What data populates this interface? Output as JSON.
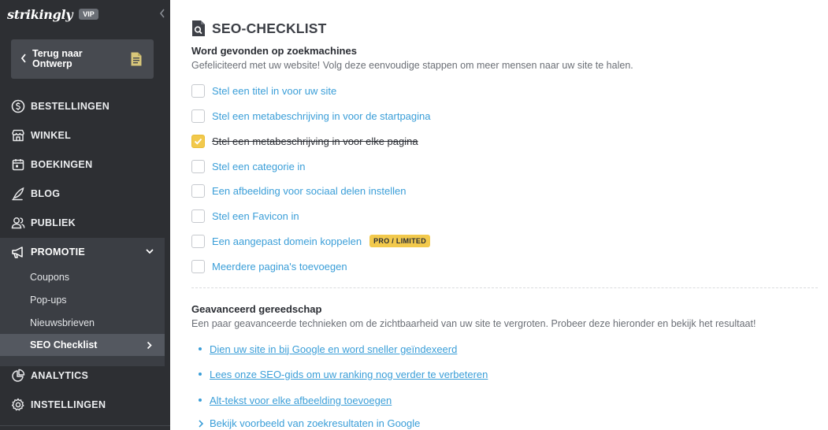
{
  "sidebar": {
    "brand": "strikingly",
    "vip_badge": "VIP",
    "back_button": "Terug naar Ontwerp",
    "nav": {
      "orders": "BESTELLINGEN",
      "store": "WINKEL",
      "bookings": "BOEKINGEN",
      "blog": "BLOG",
      "audience": "PUBLIEK",
      "promotion": "PROMOTIE",
      "analytics": "ANALYTICS",
      "settings": "INSTELLINGEN"
    },
    "promotion_sub": {
      "coupons": "Coupons",
      "popups": "Pop-ups",
      "newsletters": "Nieuwsbrieven",
      "seo": "SEO Checklist"
    }
  },
  "main": {
    "title": "SEO-CHECKLIST",
    "section1": {
      "heading": "Word gevonden op zoekmachines",
      "description": "Gefeliciteerd met uw website! Volg deze eenvoudige stappen om meer mensen naar uw site te halen.",
      "items": [
        {
          "label": "Stel een titel in voor uw site",
          "checked": false
        },
        {
          "label": "Stel een metabeschrijving in voor de startpagina",
          "checked": false
        },
        {
          "label": "Stel een metabeschrijving in voor elke pagina",
          "checked": true
        },
        {
          "label": "Stel een categorie in",
          "checked": false
        },
        {
          "label": "Een afbeelding voor sociaal delen instellen",
          "checked": false
        },
        {
          "label": "Stel een Favicon in",
          "checked": false
        },
        {
          "label": "Een aangepast domein koppelen",
          "checked": false,
          "badge": "PRO / LIMITED"
        },
        {
          "label": "Meerdere pagina's toevoegen",
          "checked": false
        }
      ]
    },
    "section2": {
      "heading": "Geavanceerd gereedschap",
      "description": "Een paar geavanceerde technieken om de zichtbaarheid van uw site te vergroten. Probeer deze hieronder en bekijk het resultaat!",
      "links": [
        "Dien uw site in bij Google en word sneller geïndexeerd",
        "Lees onze SEO-gids om uw ranking nog verder te verbeteren",
        "Alt-tekst voor elke afbeelding toevoegen"
      ],
      "expander": "Bekijk voorbeeld van zoekresultaten in Google"
    }
  },
  "colors": {
    "sidebar_bg": "#2d2f33",
    "accent_link": "#3a9ed8",
    "checkbox_checked": "#f2c94c"
  }
}
